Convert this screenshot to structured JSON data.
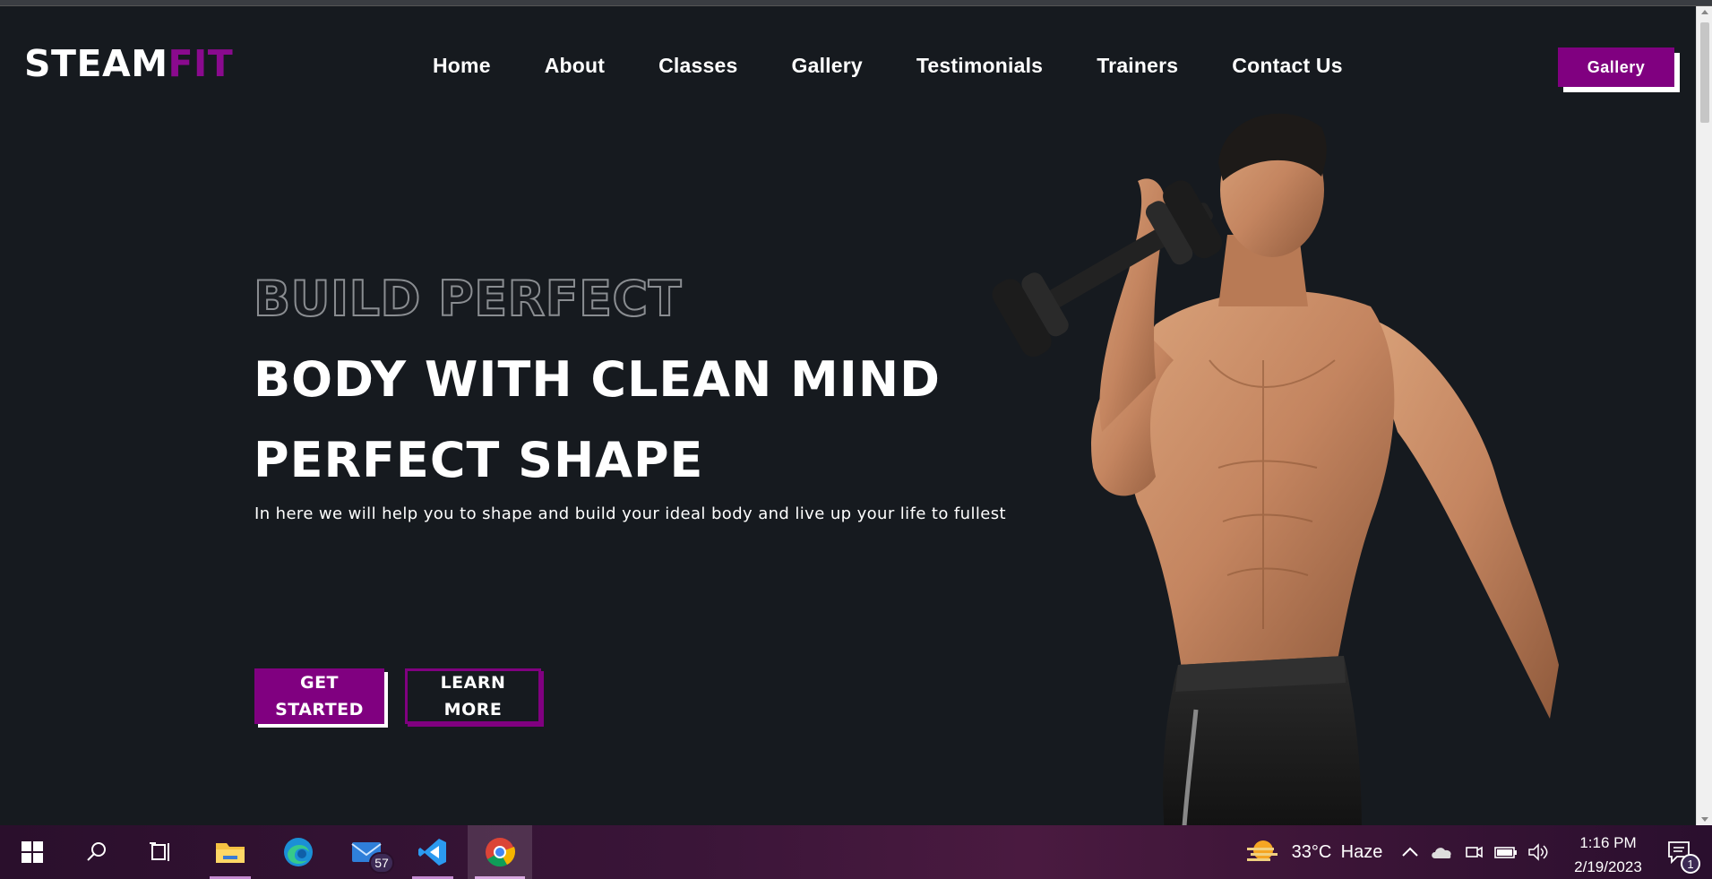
{
  "brand": {
    "part1": "STEAM",
    "part2": "FIT"
  },
  "nav": {
    "items": [
      {
        "label": "Home"
      },
      {
        "label": "About"
      },
      {
        "label": "Classes"
      },
      {
        "label": "Gallery"
      },
      {
        "label": "Testimonials"
      },
      {
        "label": "Trainers"
      },
      {
        "label": "Contact Us"
      }
    ],
    "cta_label": "Gallery"
  },
  "hero": {
    "outline_line": "BUILD PERFECT",
    "line1": "BODY WITH CLEAN MIND",
    "line2": "PERFECT SHAPE",
    "subtitle": "In here we will help you to shape and build your ideal body and live up your life to fullest",
    "btn_get_1": "GET",
    "btn_get_2": "STARTED",
    "btn_learn_1": "LEARN",
    "btn_learn_2": "MORE"
  },
  "colors": {
    "accent": "#800080",
    "background": "#161a1f"
  },
  "taskbar": {
    "mail_badge": "57",
    "weather_temp": "33°C",
    "weather_desc": "Haze",
    "time": "1:16 PM",
    "date": "2/19/2023",
    "notif_count": "1",
    "icons": [
      "windows-start-icon",
      "search-icon",
      "task-view-icon",
      "file-explorer-icon",
      "edge-icon",
      "mail-icon",
      "vscode-icon",
      "chrome-icon"
    ]
  }
}
